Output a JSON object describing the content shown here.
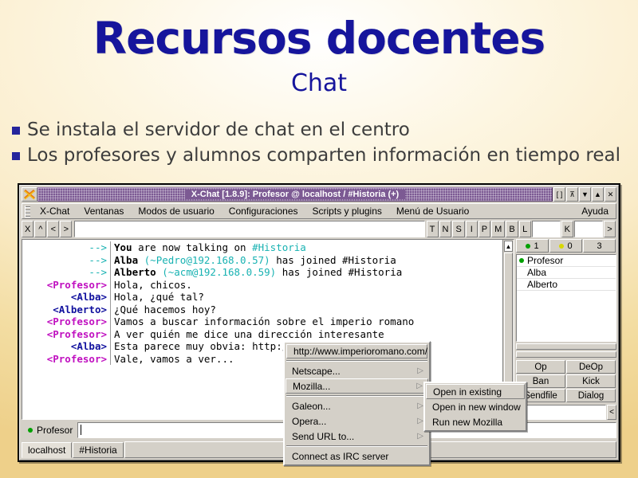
{
  "slide": {
    "title": "Recursos docentes",
    "subtitle": "Chat",
    "bullets": [
      "Se instala el servidor de chat en el centro",
      "Los profesores y alumnos comparten información en tiempo real"
    ],
    "colors": {
      "title": "#16159c",
      "bullet_square": "#25259c",
      "bullet_text": "#3d3d3d"
    }
  },
  "window": {
    "title": "X-Chat [1.8.9]: Profesor @ localhost / #Historia (+)",
    "app_icon": "xchat-icon",
    "titlebar_color": "#7c5a93",
    "buttons": [
      {
        "name": "shade-button",
        "glyph": "[ ]"
      },
      {
        "name": "stick-button",
        "glyph": "⊼"
      },
      {
        "name": "minimize-button",
        "glyph": "▼"
      },
      {
        "name": "maximize-button",
        "glyph": "▲"
      },
      {
        "name": "close-button",
        "glyph": "✕"
      }
    ]
  },
  "menubar": {
    "items": [
      "X-Chat",
      "Ventanas",
      "Modos de usuario",
      "Configuraciones",
      "Scripts y plugins",
      "Menú de Usuario"
    ],
    "help": "Ayuda"
  },
  "modebar": {
    "left_buttons": [
      "X",
      "^",
      "<",
      ">"
    ],
    "topic_value": "",
    "mode_flags": [
      "T",
      "N",
      "S",
      "I",
      "P",
      "M",
      "B",
      "L"
    ],
    "key_button": "K",
    "limit_value": "",
    "key_value": "",
    "more_button": ">"
  },
  "chat": {
    "lines": [
      {
        "nick": "-->",
        "nick_class": "c-arrow",
        "parts": [
          {
            "t": "You",
            "c": "b"
          },
          {
            "t": " are now talking on ",
            "c": ""
          },
          {
            "t": "#Historia",
            "c": "c-chan"
          }
        ]
      },
      {
        "nick": "-->",
        "nick_class": "c-arrow",
        "parts": [
          {
            "t": "Alba",
            "c": "b"
          },
          {
            "t": " ",
            "c": ""
          },
          {
            "t": "(~Pedro@192.168.0.57)",
            "c": "c-host"
          },
          {
            "t": " has joined #Historia",
            "c": ""
          }
        ]
      },
      {
        "nick": "-->",
        "nick_class": "c-arrow",
        "parts": [
          {
            "t": "Alberto",
            "c": "b"
          },
          {
            "t": " ",
            "c": ""
          },
          {
            "t": "(~acm@192.168.0.59)",
            "c": "c-host"
          },
          {
            "t": " has joined #Historia",
            "c": ""
          }
        ]
      },
      {
        "nick": "<Profesor>",
        "nick_class": "c-prof",
        "parts": [
          {
            "t": "Hola, chicos.",
            "c": ""
          }
        ]
      },
      {
        "nick": "<Alba>",
        "nick_class": "c-blue",
        "parts": [
          {
            "t": "Hola, ¿qué tal?",
            "c": ""
          }
        ]
      },
      {
        "nick": "<Alberto>",
        "nick_class": "c-blue",
        "parts": [
          {
            "t": "¿Qué hacemos hoy?",
            "c": ""
          }
        ]
      },
      {
        "nick": "<Profesor>",
        "nick_class": "c-prof",
        "parts": [
          {
            "t": "Vamos a buscar información sobre el imperio romano",
            "c": ""
          }
        ]
      },
      {
        "nick": "<Profesor>",
        "nick_class": "c-prof",
        "parts": [
          {
            "t": "A ver quién me dice una dirección interesante",
            "c": ""
          }
        ]
      },
      {
        "nick": "<Alba>",
        "nick_class": "c-blue",
        "parts": [
          {
            "t": "Esta parece muy obvia: http://www.imperioromano.com/",
            "c": ""
          }
        ]
      },
      {
        "nick": "<Profesor>",
        "nick_class": "c-prof",
        "parts": [
          {
            "t": "Vale, vamos a ver...",
            "c": ""
          }
        ]
      }
    ]
  },
  "sidebar": {
    "counts": [
      {
        "name": "ops-count",
        "dot": "#00a000",
        "value": "1"
      },
      {
        "name": "voiced-count",
        "dot": "#d8d800",
        "value": "0"
      },
      {
        "name": "total-count",
        "dot": "",
        "value": "3"
      }
    ],
    "users": [
      {
        "name": "Profesor",
        "op": true
      },
      {
        "name": "Alba",
        "op": false
      },
      {
        "name": "Alberto",
        "op": false
      }
    ],
    "buttons": [
      [
        "Op",
        "DeOp"
      ],
      [
        "Ban",
        "Kick"
      ],
      [
        "Sendfile",
        "Dialog"
      ]
    ],
    "entry_value": "",
    "entry_arrow": "<"
  },
  "input": {
    "nick": "Profesor",
    "nick_dot": "#00a000",
    "value": ""
  },
  "tabs": [
    {
      "label": "localhost",
      "active": true
    },
    {
      "label": "#Historia",
      "active": false
    }
  ],
  "url_menu": {
    "url": "http://www.imperioromano.com/",
    "items": [
      {
        "label": "Netscape...",
        "submenu": true,
        "highlight": false
      },
      {
        "label": "Mozilla...",
        "submenu": true,
        "highlight": true
      },
      {
        "label": "Galeon...",
        "submenu": true,
        "highlight": false
      },
      {
        "label": "Opera...",
        "submenu": true,
        "highlight": false
      },
      {
        "label": "Send URL to...",
        "submenu": true,
        "highlight": false
      },
      {
        "label": "Connect as IRC server",
        "submenu": false,
        "highlight": false
      }
    ]
  },
  "sub_menu": {
    "items": [
      {
        "label": "Open in existing",
        "highlight": true
      },
      {
        "label": "Open in new window",
        "highlight": false
      },
      {
        "label": "Run new Mozilla",
        "highlight": false
      }
    ]
  }
}
